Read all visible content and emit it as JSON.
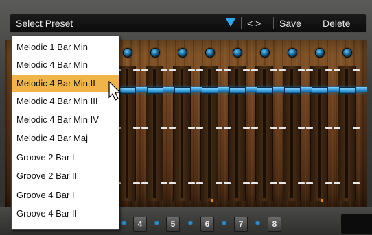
{
  "header": {
    "preset_label": "Select Preset",
    "nav_label": "< >",
    "save_label": "Save",
    "delete_label": "Delete",
    "dropdown_icon": "triangle-down-icon",
    "accent_color": "#2aa8f0"
  },
  "preset_menu": {
    "items": [
      "Melodic 1 Bar Min",
      "Melodic 4 Bar Min",
      "Melodic 4 Bar Min II",
      "Melodic 4 Bar Min III",
      "Melodic 4 Bar Min IV",
      "Melodic 4 Bar Maj",
      "Groove 2 Bar I",
      "Groove 2 Bar II",
      "Groove 4 Bar I",
      "Groove 4 Bar II"
    ],
    "highlighted_index": 2,
    "highlight_color": "#f0b449"
  },
  "step_pages": [
    "4",
    "5",
    "6",
    "7",
    "8"
  ]
}
